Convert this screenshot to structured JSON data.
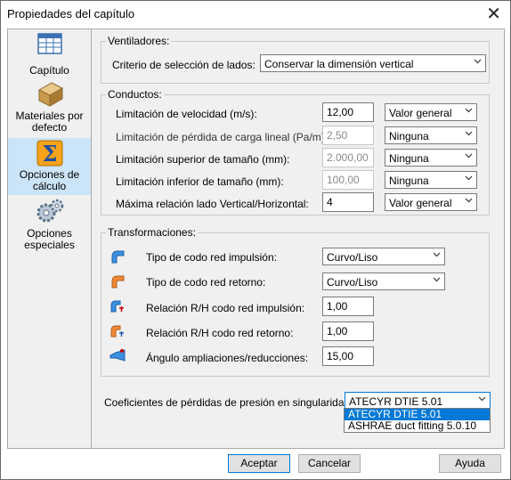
{
  "window": {
    "title": "Propiedades del capítulo",
    "close_glyph": "✕"
  },
  "sidebar": {
    "items": [
      {
        "label": "Capítulo",
        "icon": "table-icon"
      },
      {
        "label": "Materiales por defecto",
        "icon": "duct-material-icon"
      },
      {
        "label": "Opciones de cálculo",
        "icon": "sigma-icon",
        "selected": true
      },
      {
        "label": "Opciones especiales",
        "icon": "gears-icon"
      }
    ]
  },
  "ventiladores": {
    "legend": "Ventiladores:",
    "criterio_label": "Criterio de selección de lados:",
    "criterio_value": "Conservar la dimensión  vertical"
  },
  "conductos": {
    "legend": "Conductos:",
    "rows": [
      {
        "label": "Limitación de velocidad (m/s):",
        "value": "12,00",
        "enabled": true,
        "option": "Valor general"
      },
      {
        "label": "Limitación de pérdida de carga lineal (Pa/m):",
        "value": "2,50",
        "enabled": false,
        "option": "Ninguna"
      },
      {
        "label": "Limitación superior de tamaño (mm):",
        "value": "2.000,00",
        "enabled": false,
        "option": "Ninguna"
      },
      {
        "label": "Limitación inferior de tamaño (mm):",
        "value": "100,00",
        "enabled": false,
        "option": "Ninguna"
      },
      {
        "label": "Máxima relación lado Vertical/Horizontal:",
        "value": "4",
        "enabled": true,
        "option": "Valor general"
      }
    ]
  },
  "transformaciones": {
    "legend": "Transformaciones:",
    "rows": [
      {
        "label": "Tipo de codo red impulsión:",
        "value": "Curvo/Liso",
        "kind": "combo",
        "icon": "elbow-supply-icon"
      },
      {
        "label": "Tipo de codo red retorno:",
        "value": "Curvo/Liso",
        "kind": "combo",
        "icon": "elbow-return-icon"
      },
      {
        "label": "Relación R/H codo red impulsión:",
        "value": "1,00",
        "kind": "text",
        "icon": "ratio-supply-icon"
      },
      {
        "label": "Relación R/H codo red retorno:",
        "value": "1,00",
        "kind": "text",
        "icon": "ratio-return-icon"
      },
      {
        "label": "Ángulo ampliaciones/reducciones:",
        "value": "15,00",
        "kind": "text",
        "icon": "angle-transition-icon"
      }
    ]
  },
  "coeficientes": {
    "label": "Coeficientes de pérdidas de presión en singularidades Co:",
    "value": "ATECYR DTIE 5.01",
    "options": [
      "ATECYR DTIE 5.01",
      "ASHRAE duct fitting 5.0.10"
    ]
  },
  "buttons": {
    "accept": "Aceptar",
    "cancel": "Cancelar",
    "help": "Ayuda"
  },
  "colors": {
    "selection": "#0078d7",
    "sidebar_selected": "#cce4f7",
    "panel": "#f0f0f0"
  }
}
